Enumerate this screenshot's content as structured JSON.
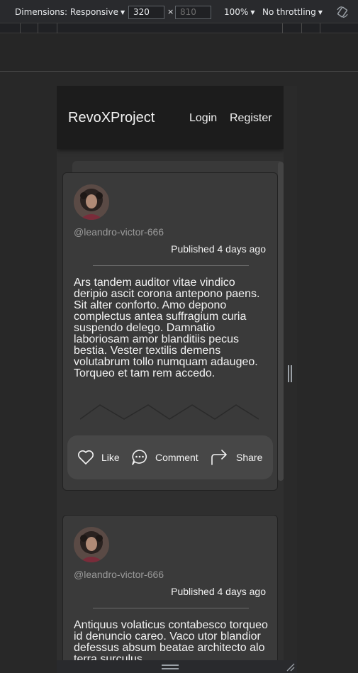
{
  "devtools": {
    "dimensions_label": "Dimensions: Responsive",
    "width_value": "320",
    "times": "×",
    "height_placeholder": "810",
    "zoom_label": "100%",
    "throttling_label": "No throttling",
    "rotate_icon": "rotate-icon"
  },
  "app": {
    "brand": "RevoXProject",
    "nav": {
      "login": "Login",
      "register": "Register"
    }
  },
  "posts": [
    {
      "username": "@leandro-victor-666",
      "published": "Published 4 days ago",
      "text": "Ars tandem auditor vitae vindico deripio ascit corona antepono paens. Sit alter conforto. Amo depono complectus antea suffragium curia suspendo delego. Damnatio laboriosam amor blanditiis pecus bestia. Vester textilis demens volutabrum tollo numquam adaugeo. Torqueo et tam rem accedo.",
      "actions": {
        "like": "Like",
        "comment": "Comment",
        "share": "Share"
      }
    },
    {
      "username": "@leandro-victor-666",
      "published": "Published 4 days ago",
      "text": "Antiquus volaticus contabesco torqueo id denuncio careo. Vaco utor blandior defessus absum beatae architecto alo terra surculus"
    }
  ],
  "colors": {
    "accent_bg": "#3a3a3a",
    "appbar_bg": "#1c1c1c",
    "action_bar_bg": "#474747",
    "text": "#f2f2f2",
    "muted": "#9a9a9a"
  }
}
